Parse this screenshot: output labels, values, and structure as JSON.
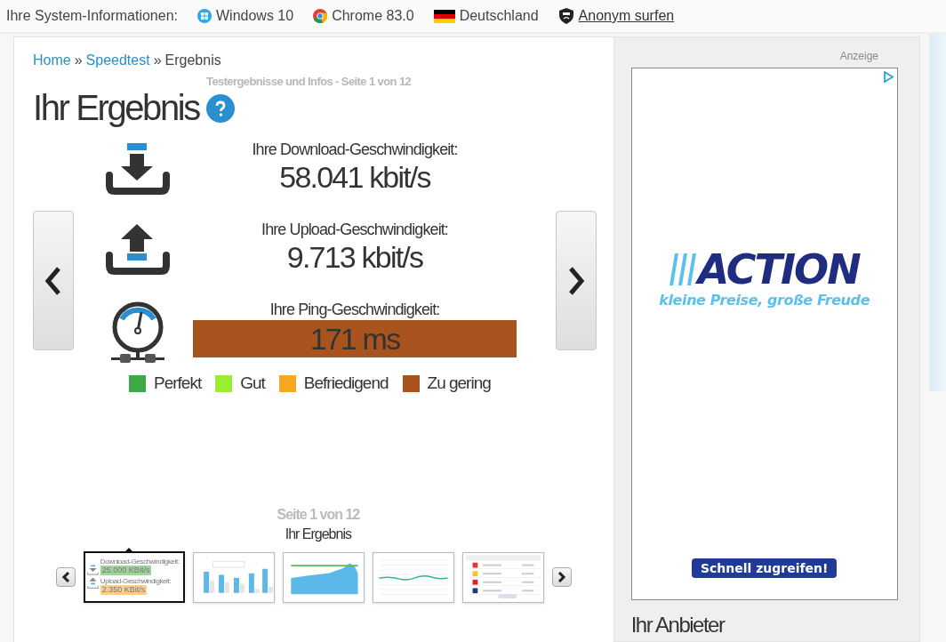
{
  "system_info": {
    "label": "Ihre System-Informationen:",
    "items": [
      {
        "kind": "windows",
        "text": "Windows 10",
        "link": false
      },
      {
        "kind": "chrome",
        "text": "Chrome 83.0",
        "link": false
      },
      {
        "kind": "flag",
        "text": "Deutschland",
        "link": false
      },
      {
        "kind": "vpn",
        "text": "Anonym surfen",
        "link": true
      }
    ]
  },
  "breadcrumb": [
    {
      "kind": "link",
      "text": "Home"
    },
    {
      "kind": "separator",
      "text": "»"
    },
    {
      "kind": "link",
      "text": "Speedtest"
    },
    {
      "kind": "separator",
      "text": "»"
    },
    {
      "kind": "current",
      "text": "Ergebnis"
    }
  ],
  "page_info": "Testergebnisse und Infos - Seite 1 von 12",
  "heading": "Ihr Ergebnis",
  "results": [
    {
      "kind": "download",
      "label": "Ihre Download-Geschwindigkeit:",
      "value": "58.041 kbit/s"
    },
    {
      "kind": "upload",
      "label": "Ihre Upload-Geschwindigkeit:",
      "value": "9.713 kbit/s"
    },
    {
      "kind": "ping",
      "label": "Ihre Ping-Geschwindigkeit:",
      "value": "171 ms",
      "color": "#a9531f"
    }
  ],
  "legend": [
    {
      "label": "Perfekt",
      "color": "#3daa47"
    },
    {
      "label": "Gut",
      "color": "#99ee33"
    },
    {
      "label": "Befriedigend",
      "color": "#f7a823"
    },
    {
      "label": "Zu gering",
      "color": "#a9531f"
    }
  ],
  "pager": {
    "caption": "Seite 1 von 12",
    "title": "Ihr Ergebnis",
    "thumbnails": [
      {
        "kind": "speed",
        "selected": true,
        "download_label": "Download-Geschwindigkeit:",
        "download_value": "25.000 KBit/s",
        "upload_label": "Upload-Geschwindigkeit:",
        "upload_value": "2.350 KBit/s"
      },
      {
        "kind": "bars",
        "selected": false
      },
      {
        "kind": "area",
        "selected": false
      },
      {
        "kind": "line",
        "selected": false
      },
      {
        "kind": "table",
        "selected": false
      }
    ]
  },
  "ad": {
    "label": "Anzeige",
    "brand": "ACTION",
    "slogan": "kleine Preise, große Freude",
    "button": "Schnell zugreifen!"
  },
  "sidebar_heading": "Ihr Anbieter"
}
